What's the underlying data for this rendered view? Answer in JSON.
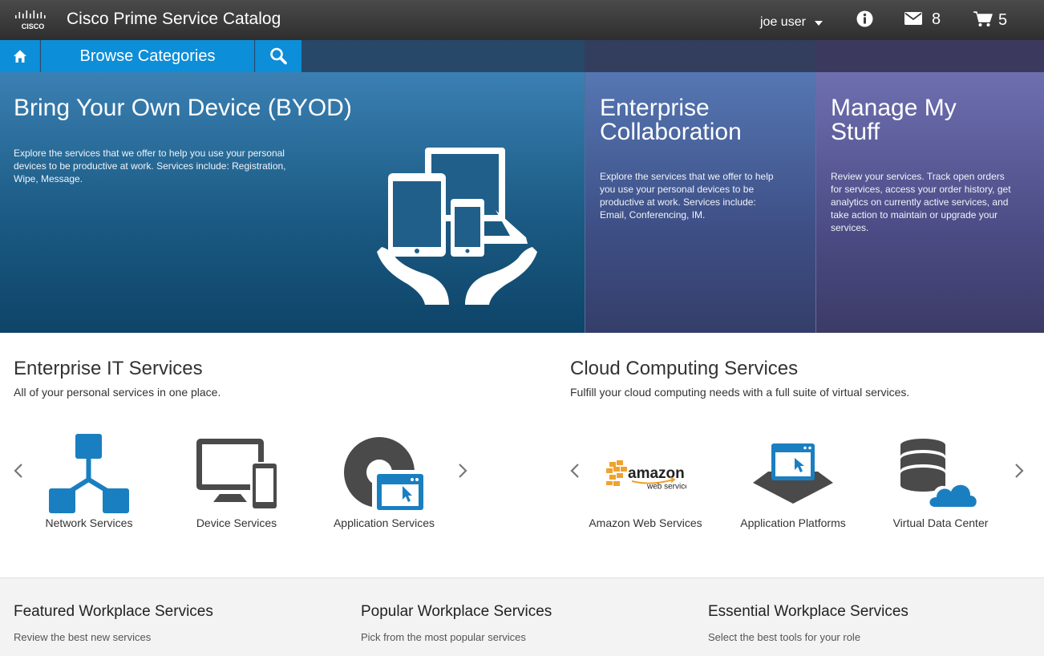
{
  "header": {
    "logo_text": "CISCO",
    "app_title": "Cisco Prime Service Catalog",
    "user_name": "joe user",
    "notifications_count": "8",
    "cart_count": "5"
  },
  "nav": {
    "browse_label": "Browse Categories"
  },
  "hero": {
    "byod": {
      "title": "Bring Your Own Device (BYOD)",
      "description": "Explore the services that we offer to help you use your personal devices to be productive at work. Services include: Registration, Wipe, Message."
    },
    "collaboration": {
      "title_line1": "Enterprise",
      "title_line2": "Collaboration",
      "description": "Explore the services that we offer to help you use your personal devices to be productive at work. Services include: Email, Conferencing, IM."
    },
    "my_stuff": {
      "title_line1": "Manage My",
      "title_line2": "Stuff",
      "description": "Review your services. Track open orders for services, access your order history, get analytics on currently active services, and take action to maintain or upgrade your services."
    }
  },
  "enterprise_it": {
    "title": "Enterprise IT Services",
    "subtitle": "All of your personal services in one place.",
    "items": [
      {
        "label": "Network Services",
        "icon": "network-icon"
      },
      {
        "label": "Device Services",
        "icon": "devices-icon"
      },
      {
        "label": "Application Services",
        "icon": "application-icon"
      }
    ]
  },
  "cloud": {
    "title": "Cloud Computing Services",
    "subtitle": "Fulfill your cloud computing needs with a full suite of virtual services.",
    "items": [
      {
        "label": "Amazon Web Services",
        "icon": "amazon-logo",
        "logo_word": "amazon",
        "logo_sub": "web services"
      },
      {
        "label": "Application Platforms",
        "icon": "platform-icon"
      },
      {
        "label": "Virtual Data Center",
        "icon": "data-center-icon"
      }
    ]
  },
  "footer": {
    "featured": {
      "title": "Featured Workplace Services",
      "subtitle": "Review the best new services"
    },
    "popular": {
      "title": "Popular Workplace Services",
      "subtitle": "Pick from the most popular services"
    },
    "essential": {
      "title": "Essential Workplace Services",
      "subtitle": "Select the best tools for your role"
    }
  },
  "colors": {
    "accent_blue": "#0d8ed8",
    "icon_blue": "#1a7fc1",
    "icon_gray": "#4a4a4a"
  }
}
